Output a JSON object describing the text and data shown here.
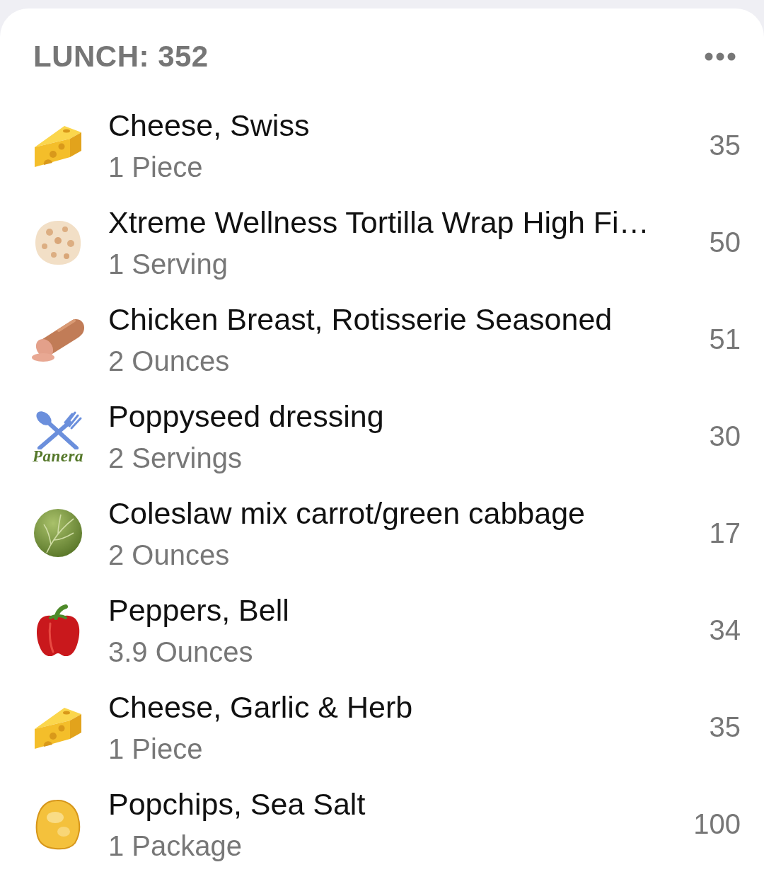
{
  "meal": {
    "title": "LUNCH: 352"
  },
  "items": [
    {
      "kind": "cheese",
      "name": "Cheese, Swiss",
      "serving": "1 Piece",
      "calories": "35"
    },
    {
      "kind": "flatbread",
      "name": "Xtreme Wellness Tortilla Wrap High Fi…",
      "serving": "1 Serving",
      "calories": "50"
    },
    {
      "kind": "sausage",
      "name": "Chicken Breast, Rotisserie Seasoned",
      "serving": "2 Ounces",
      "calories": "51"
    },
    {
      "kind": "utensils",
      "icon_caption": "Panera",
      "name": "Poppyseed dressing",
      "serving": "2 Servings",
      "calories": "30"
    },
    {
      "kind": "cabbage",
      "name": "Coleslaw mix carrot/green cabbage",
      "serving": "2 Ounces",
      "calories": "17"
    },
    {
      "kind": "pepper",
      "name": "Peppers, Bell",
      "serving": "3.9 Ounces",
      "calories": "34"
    },
    {
      "kind": "cheese",
      "name": "Cheese, Garlic & Herb",
      "serving": "1 Piece",
      "calories": "35"
    },
    {
      "kind": "chip",
      "name": "Popchips, Sea Salt",
      "serving": "1 Package",
      "calories": "100"
    }
  ]
}
